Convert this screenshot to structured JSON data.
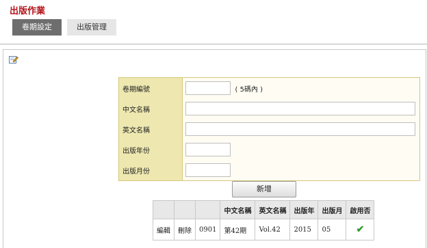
{
  "page": {
    "title": "出版作業"
  },
  "tabs": [
    {
      "label": "卷期設定",
      "active": true
    },
    {
      "label": "出版管理",
      "active": false
    }
  ],
  "form": {
    "fields": [
      {
        "label": "卷期編號",
        "value": "",
        "hint": "( 5碼內 )"
      },
      {
        "label": "中文名稱",
        "value": ""
      },
      {
        "label": "英文名稱",
        "value": ""
      },
      {
        "label": "出版年份",
        "value": ""
      },
      {
        "label": "出版月份",
        "value": ""
      }
    ],
    "add_label": "新增"
  },
  "table": {
    "headers": [
      "",
      "",
      "",
      "中文名稱",
      "英文名稱",
      "出版年",
      "出版月",
      "啟用否"
    ],
    "rows": [
      {
        "edit": "編輯",
        "delete": "刪除",
        "code": "0901",
        "zh_name": "第42期",
        "en_name": "Vol.42",
        "year": "2015",
        "month": "05",
        "enabled": "check-icon"
      }
    ]
  },
  "colors": {
    "title": "#b3141c",
    "active_tab": "#6e6e6e",
    "label_bg": "#eee8b0",
    "check": "#2f9a2f"
  }
}
